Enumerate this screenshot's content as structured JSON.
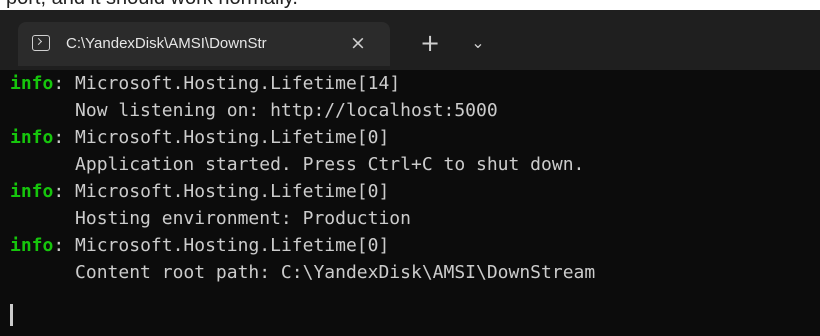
{
  "top_text": "pоrt, and it should work normally.",
  "window": {
    "tab_title": "C:\\YandexDisk\\AMSI\\DownStr",
    "close_glyph": "×",
    "new_tab_glyph": "+",
    "dropdown_glyph": "⌄"
  },
  "terminal": {
    "lines": [
      {
        "level": "info",
        "sep": ": ",
        "text": "Microsoft.Hosting.Lifetime[14]"
      },
      {
        "indent": "      ",
        "text": "Now listening on: http://localhost:5000"
      },
      {
        "level": "info",
        "sep": ": ",
        "text": "Microsoft.Hosting.Lifetime[0]"
      },
      {
        "indent": "      ",
        "text": "Application started. Press Ctrl+C to shut down."
      },
      {
        "level": "info",
        "sep": ": ",
        "text": "Microsoft.Hosting.Lifetime[0]"
      },
      {
        "indent": "      ",
        "text": "Hosting environment: Production"
      },
      {
        "level": "info",
        "sep": ": ",
        "text": "Microsoft.Hosting.Lifetime[0]"
      },
      {
        "indent": "      ",
        "text": "Content root path: C:\\YandexDisk\\AMSI\\DownStream"
      }
    ]
  },
  "colors": {
    "terminal_bg": "#0c0c0c",
    "titlebar_bg": "#1f1f1f",
    "tab_bg": "#2b2b2b",
    "info_green": "#16c60c",
    "terminal_text": "#cccccc"
  },
  "icons": {
    "tab_icon": "terminal-icon",
    "close_icon": "close-icon",
    "new_tab_icon": "plus-icon",
    "dropdown_icon": "chevron-down-icon"
  }
}
